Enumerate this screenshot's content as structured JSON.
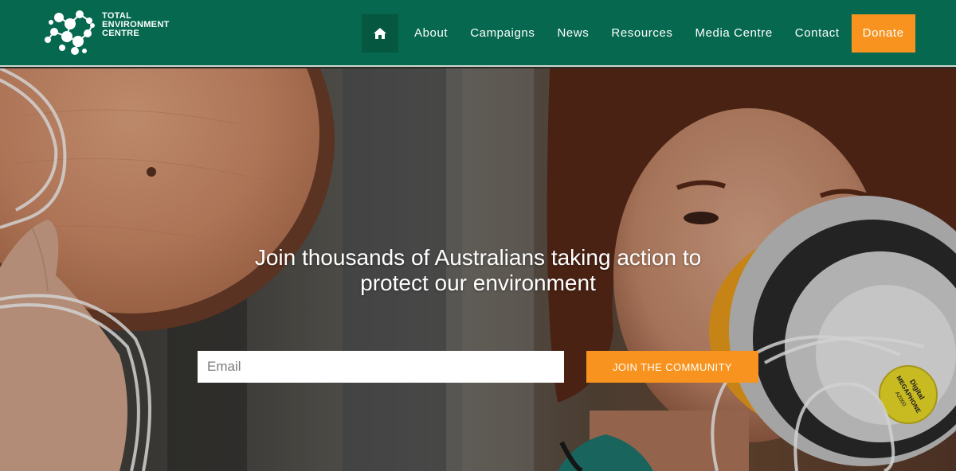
{
  "brand": {
    "logo_line1": "TOTAL",
    "logo_line2": "ENVIRONMENT",
    "logo_line3": "CENTRE"
  },
  "nav": {
    "home_icon": "home-icon",
    "items": [
      "About",
      "Campaigns",
      "News",
      "Resources",
      "Media Centre",
      "Contact"
    ],
    "donate_label": "Donate"
  },
  "hero": {
    "headline_line1": "Join thousands of Australians taking action to",
    "headline_line2": "protect our environment",
    "email_placeholder": "Email",
    "join_label": "JOIN THE COMMUNITY",
    "megaphone_label_line1": "Digital",
    "megaphone_label_line2": "MEGAPHONE",
    "megaphone_label_line3": "A2000"
  },
  "colors": {
    "header_green": "#06694f",
    "accent_orange": "#f7931e"
  }
}
